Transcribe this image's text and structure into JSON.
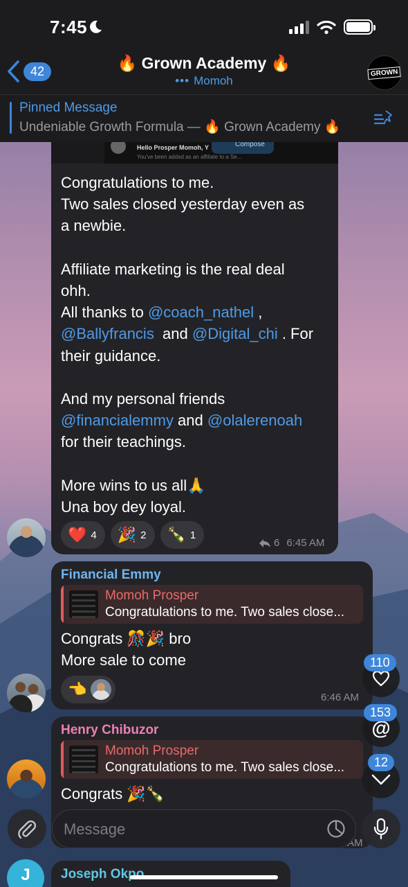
{
  "status": {
    "time": "7:45"
  },
  "header": {
    "back_count": "42",
    "title": "🔥 Grown Academy 🔥",
    "typing": "Momoh",
    "typing_dots": "•••",
    "avatar_text": "GROWN"
  },
  "pinned": {
    "label": "Pinned Message",
    "text": "Undeniable Growth Formula — 🔥 Grown Academy 🔥"
  },
  "message1": {
    "preview": {
      "greeting": "Hello Prosper Momoh, Y",
      "subtext": "You've been added as an affiliate to a Se...",
      "compose": "Compose"
    },
    "lines": {
      "l1": "Congratulations to me.",
      "l2": "Two sales closed yesterday even as",
      "l3": "a newbie.",
      "l4": "Affiliate marketing is the real deal",
      "l5": "ohh.",
      "l6a": "All thanks to ",
      "m1": "@coach_nathel",
      "l6b": " ,",
      "m2": "@Ballyfrancis",
      "l7a": "  and ",
      "m3": "@Digital_chi",
      "l7b": " . For",
      "l8": "their guidance.",
      "l9": "And my personal friends",
      "m4": "@financialemmy",
      "l10a": " and ",
      "m5": "@olalerenoah",
      "l11": "for their teachings.",
      "l12": "More wins to us all🙏",
      "l13": "Una boy dey loyal."
    },
    "reactions": [
      {
        "emoji": "❤️",
        "count": "4"
      },
      {
        "emoji": "🎉",
        "count": "2"
      },
      {
        "emoji": "🍾",
        "count": "1"
      }
    ],
    "replies": "6",
    "time": "6:45 AM"
  },
  "message2": {
    "sender": "Financial Emmy",
    "reply_to": {
      "name": "Momoh Prosper",
      "text": "Congratulations to me. Two sales close..."
    },
    "line1": "Congrats 🎊🎉 bro",
    "line2": "More sale to come",
    "reaction_emoji": "👈",
    "time": "6:46 AM"
  },
  "message3": {
    "sender": "Henry Chibuzor",
    "reply_to": {
      "name": "Momoh Prosper",
      "text": "Congratulations to me. Two sales close..."
    },
    "line1": "Congrats 🎉🍾",
    "time_partial": "AM"
  },
  "message4": {
    "sender": "Joseph Okpo",
    "avatar_letter": "J"
  },
  "floating": {
    "reactions_count": "110",
    "mentions_count": "153",
    "unread_count": "12"
  },
  "composer": {
    "placeholder": "Message"
  },
  "colors": {
    "accent": "#3e86d9",
    "bubble": "#232327",
    "financial_emmy": "#6fb6f0",
    "henry": "#ee7fb3",
    "joseph": "#5fc8e8",
    "reply_name": "#e86a6a"
  }
}
